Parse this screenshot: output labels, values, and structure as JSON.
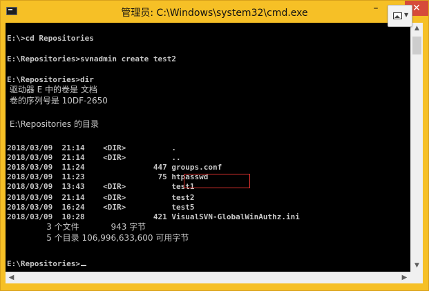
{
  "window": {
    "title": "管理员: C:\\Windows\\system32\\cmd.exe",
    "minimize_label": "–",
    "close_label": "✕",
    "icon": "cmd-icon"
  },
  "console": {
    "lines": [
      "",
      "E:\\>cd Repositories",
      "",
      "E:\\Repositories>svnadmin create test2",
      "",
      "E:\\Repositories>dir",
      " 驱动器 E 中的卷是 文档",
      " 卷的序列号是 10DF-2650",
      "",
      " E:\\Repositories 的目录",
      "",
      "2018/03/09  21:14    <DIR>          .",
      "2018/03/09  21:14    <DIR>          ..",
      "2018/03/09  11:24               447 groups.conf",
      "2018/03/09  11:23                75 htpasswd",
      "2018/03/09  13:43    <DIR>          test1",
      "2018/03/09  21:14    <DIR>          test2",
      "2018/03/09  16:24    <DIR>          test5",
      "2018/03/09  10:28               421 VisualSVN-GlobalWinAuthz.ini",
      "               3 个文件            943 字节",
      "               5 个目录 106,996,633,600 可用字节",
      "",
      "E:\\Repositories>"
    ],
    "highlighted_entry": "test2",
    "text_color": "#c8c8c8",
    "background": "#000000",
    "highlight_color": "#e0322f"
  },
  "scrollbars": {
    "up_arrow": "▲",
    "down_arrow": "▼",
    "left_arrow": "◀",
    "right_arrow": "▶"
  },
  "colors": {
    "titlebar": "#f6c026",
    "close": "#d64b3a"
  }
}
